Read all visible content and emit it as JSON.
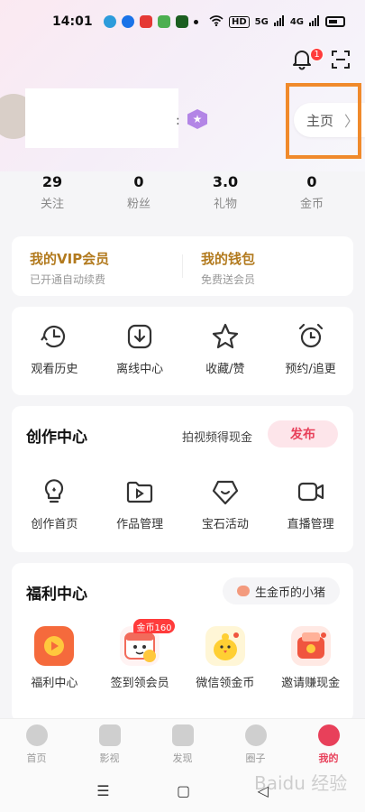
{
  "status_bar": {
    "time": "14:01",
    "network": "HD",
    "signal_5g": "5G",
    "signal_4g": "4G"
  },
  "header": {
    "notification_count": "1"
  },
  "profile": {
    "colon": ":",
    "home_label": "主页",
    "home_arrow": "〉"
  },
  "stats": [
    {
      "value": "29",
      "label": "关注"
    },
    {
      "value": "0",
      "label": "粉丝"
    },
    {
      "value": "3.0",
      "label": "礼物"
    },
    {
      "value": "0",
      "label": "金币"
    }
  ],
  "vip": {
    "member_title": "我的VIP会员",
    "member_sub": "已开通自动续费",
    "wallet_title": "我的钱包",
    "wallet_sub": "免费送会员"
  },
  "quick": [
    {
      "label": "观看历史",
      "icon": "history-icon"
    },
    {
      "label": "离线中心",
      "icon": "download-icon"
    },
    {
      "label": "收藏/赞",
      "icon": "star-icon"
    },
    {
      "label": "预约/追更",
      "icon": "alarm-icon"
    }
  ],
  "create": {
    "title": "创作中心",
    "hint": "拍视频得现金",
    "publish": "发布",
    "items": [
      {
        "label": "创作首页",
        "icon": "bulb-icon"
      },
      {
        "label": "作品管理",
        "icon": "folder-icon"
      },
      {
        "label": "宝石活动",
        "icon": "gem-icon"
      },
      {
        "label": "直播管理",
        "icon": "camera-icon"
      }
    ]
  },
  "welfare": {
    "title": "福利中心",
    "piggy": "生金币的小猪",
    "coin_badge": "金币160",
    "items": [
      {
        "label": "福利中心",
        "icon": "welfare-icon",
        "color": "#f56a3c"
      },
      {
        "label": "签到领会员",
        "icon": "calendar-icon",
        "color": "#f9c84a"
      },
      {
        "label": "微信领金币",
        "icon": "chick-icon",
        "color": "#ffcf33"
      },
      {
        "label": "邀请赚现金",
        "icon": "wallet-icon",
        "color": "#f0553f"
      }
    ]
  },
  "nav": [
    {
      "label": "首页",
      "icon": "home-icon"
    },
    {
      "label": "影视",
      "icon": "video-icon"
    },
    {
      "label": "发现",
      "icon": "discover-icon"
    },
    {
      "label": "圈子",
      "icon": "circle-icon"
    },
    {
      "label": "我的",
      "icon": "profile-icon",
      "active": true
    }
  ],
  "system_nav": {
    "menu": "☰",
    "home": "▢",
    "back": "◁"
  },
  "watermark": "Baidu 经验",
  "colors": {
    "accent": "#e8405a",
    "vip_gold": "#b27a1e",
    "highlight": "#f08a2b"
  }
}
